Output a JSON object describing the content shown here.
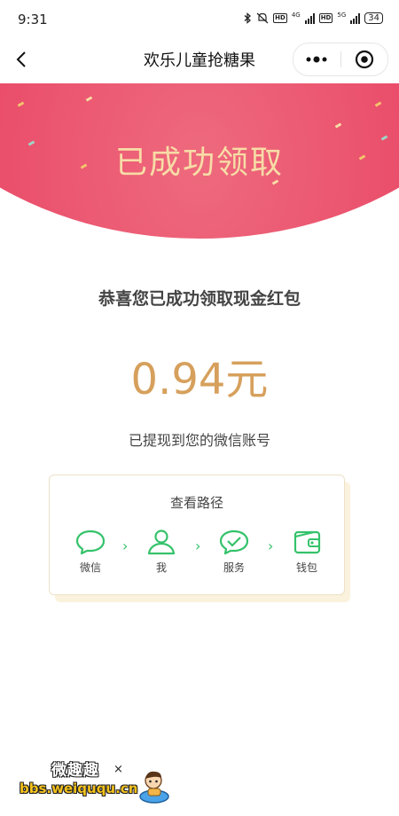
{
  "status_bar": {
    "time": "9:31",
    "net1": "4G",
    "net2": "5G",
    "hd": "HD",
    "battery": "34"
  },
  "nav": {
    "title": "欢乐儿童抢糖果",
    "more_icon": "more-dots-icon",
    "close_icon": "target-circle-icon"
  },
  "banner": {
    "title": "已成功领取",
    "colors": {
      "background": "#e84866",
      "title": "#f7dca6"
    }
  },
  "result": {
    "congrats": "恭喜您已成功领取现金红包",
    "amount": "0.94元",
    "note": "已提现到您的微信账号"
  },
  "path_card": {
    "title": "查看路径",
    "steps": [
      {
        "label": "微信",
        "icon": "chat-bubble-icon"
      },
      {
        "label": "我",
        "icon": "person-icon"
      },
      {
        "label": "服务",
        "icon": "check-bubble-icon"
      },
      {
        "label": "钱包",
        "icon": "wallet-icon"
      }
    ],
    "separator": "›",
    "accent": "#34c26a"
  },
  "watermark": {
    "site_name": "微趣趣",
    "url": "bbs.weiququ.cn",
    "mark": "×"
  }
}
